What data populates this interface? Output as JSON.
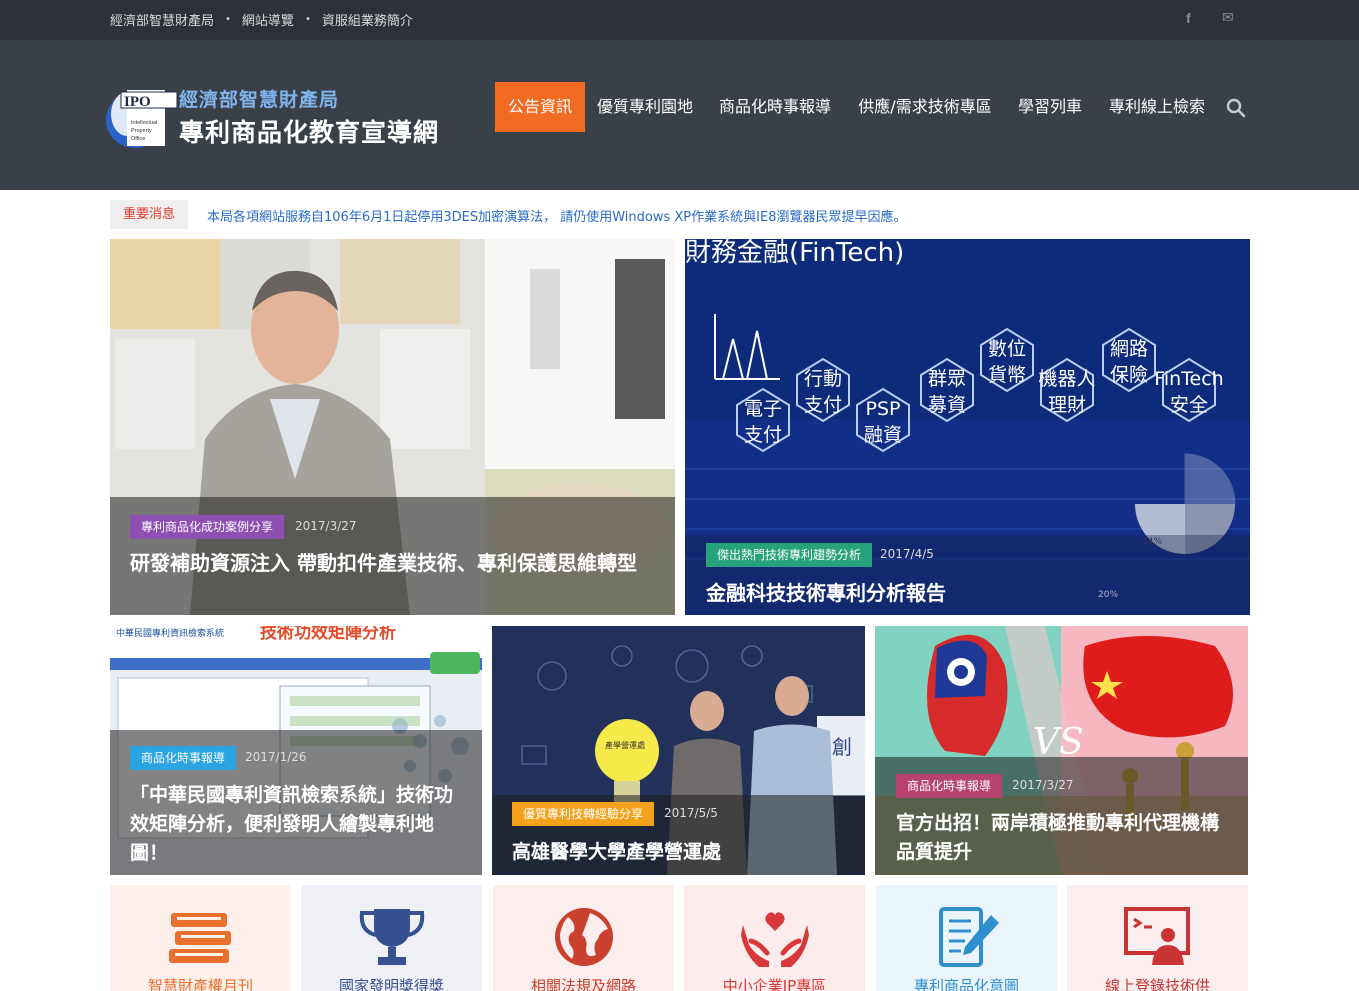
{
  "topbar": {
    "links": [
      "經濟部智慧財產局",
      "網站導覽",
      "資服組業務簡介"
    ],
    "separator": "•",
    "social": {
      "facebook_icon": "f",
      "mail_icon": "✉"
    }
  },
  "logo": {
    "badge": "IPO",
    "badge_sub": "Intellectual Property Office",
    "line1": "經濟部智慧財產局",
    "line2": "專利商品化教育宣導網"
  },
  "nav": {
    "items": [
      "公告資訊",
      "優質專利園地",
      "商品化時事報導",
      "供應/需求技術專區",
      "學習列車",
      "專利線上檢索"
    ],
    "active_index": 0,
    "search_icon": "search-icon"
  },
  "news": {
    "label": "重要消息",
    "text": "本局各項網站服務自106年6月1日起停用3DES加密演算法， 請仍使用Windows XP作業系統與IE8瀏覽器民眾提早因應。"
  },
  "featured": [
    {
      "tag": "專利商品化成功案例分享",
      "tag_color": "#8e4fb3",
      "date": "2017/3/27",
      "title": "研發補助資源注入 帶動扣件產業技術、專利保護思維轉型"
    },
    {
      "tag": "傑出熱門技術專利趨勢分析",
      "tag_color": "#27a27a",
      "date": "2017/4/5",
      "title": "金融科技技術專利分析報告",
      "image_text": {
        "heading": "財務金融(FinTech)",
        "nodes": [
          "電子 支付",
          "行動 支付",
          "PSP 融資",
          "群眾 募資",
          "數位 貨幣",
          "機器人 理財",
          "網路 保險",
          "FinTech 安全"
        ],
        "pie": [
          "34%",
          "20%"
        ]
      }
    }
  ],
  "cards": [
    {
      "tag": "商品化時事報導",
      "tag_color": "#2ba3e0",
      "date": "2017/1/26",
      "title": "「中華民國專利資訊檢索系統」技術功效矩陣分析，便利發明人繪製專利地圖！",
      "image_text": {
        "heading": "技術功效矩陣分析",
        "system": "中華民國專利資訊檢索系統"
      }
    },
    {
      "tag": "優質專利技轉經驗分享",
      "tag_color": "#f4a21b",
      "date": "2017/5/5",
      "title": "高雄醫學大學產學營運處",
      "image_text": {
        "bulb": "產學營運處",
        "sign": "創"
      }
    },
    {
      "tag": "商品化時事報導",
      "tag_color": "#b5436e",
      "date": "2017/3/27",
      "title": "官方出招！兩岸積極推動專利代理機構品質提升",
      "image_text": {
        "vs": "VS"
      }
    }
  ],
  "tiles": [
    {
      "label": "智慧財產權月刊",
      "bg": "#fdf0eb",
      "color": "#e86f2c",
      "icon": "books-icon"
    },
    {
      "label": "國家發明獎得獎",
      "bg": "#eef0f5",
      "color": "#37508f",
      "icon": "trophy-icon"
    },
    {
      "label": "相關法規及網路",
      "bg": "#fbeeed",
      "color": "#c9402f",
      "icon": "globe-icon"
    },
    {
      "label": "中小企業IP專區",
      "bg": "#fdecec",
      "color": "#d8383a",
      "icon": "heart-hands-icon"
    },
    {
      "label": "專利商品化意圖",
      "bg": "#eaf4fb",
      "color": "#2e8fcf",
      "icon": "document-pen-icon"
    },
    {
      "label": "線上登錄技術供",
      "bg": "#fbeeee",
      "color": "#c93333",
      "icon": "presenter-icon"
    }
  ]
}
